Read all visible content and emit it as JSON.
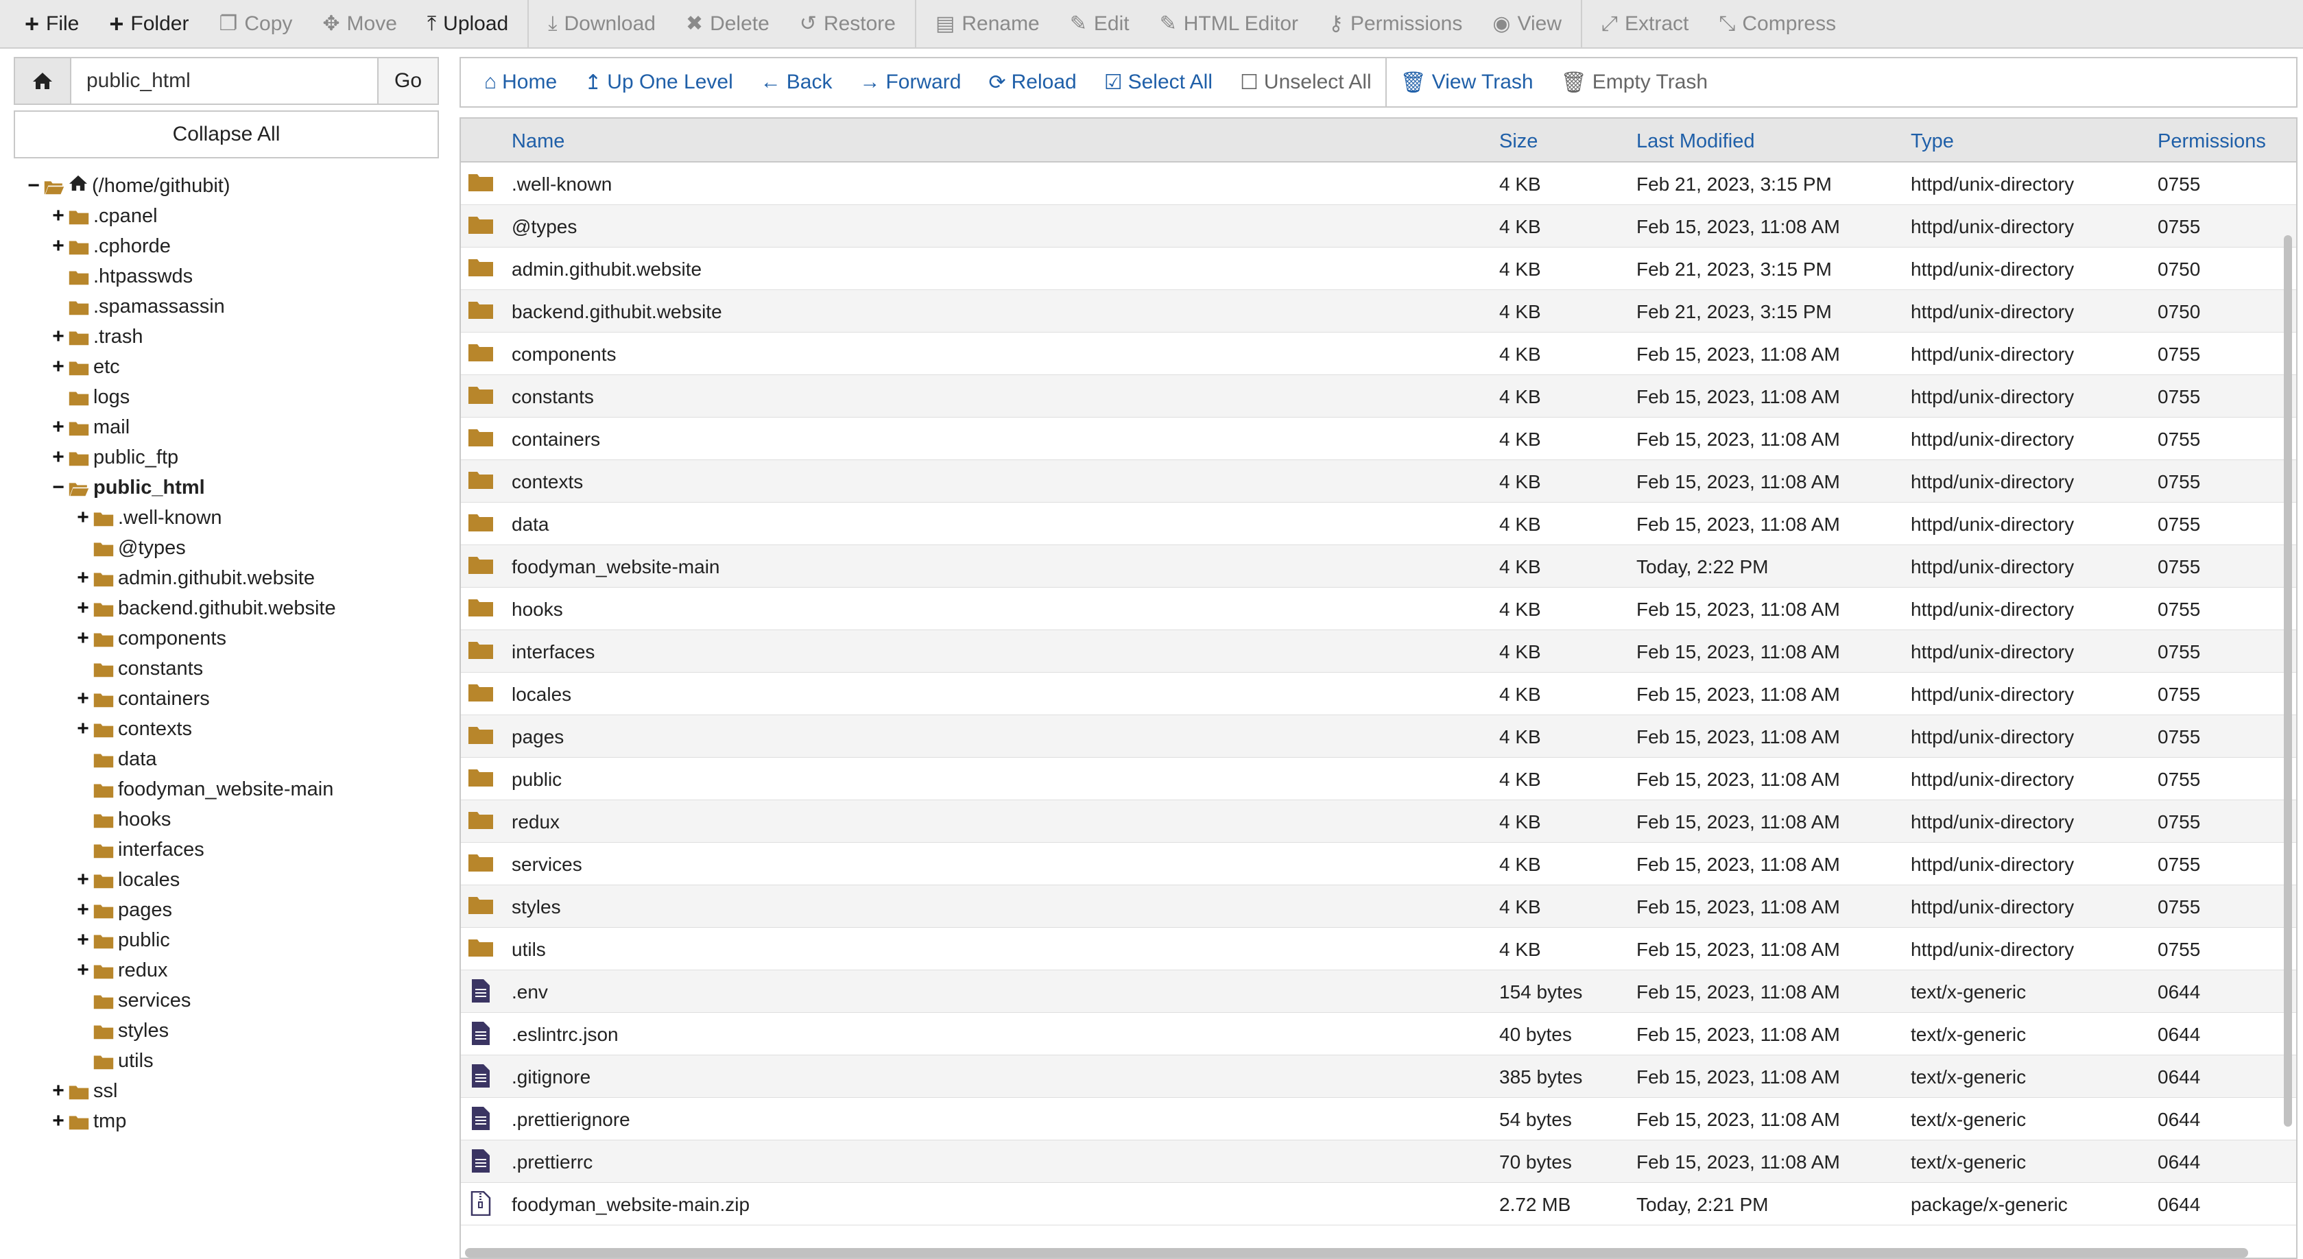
{
  "toolbar": {
    "items": [
      {
        "label": "File",
        "icon": "plus-icon",
        "active": true
      },
      {
        "label": "Folder",
        "icon": "plus-icon",
        "active": true
      },
      {
        "label": "Copy",
        "icon": "copy-icon",
        "active": false
      },
      {
        "label": "Move",
        "icon": "move-icon",
        "active": false
      },
      {
        "label": "Upload",
        "icon": "upload-icon",
        "active": true
      },
      {
        "label": "Download",
        "icon": "download-icon",
        "active": false
      },
      {
        "label": "Delete",
        "icon": "delete-icon",
        "active": false
      },
      {
        "label": "Restore",
        "icon": "restore-icon",
        "active": false
      },
      {
        "label": "Rename",
        "icon": "rename-icon",
        "active": false
      },
      {
        "label": "Edit",
        "icon": "edit-icon",
        "active": false
      },
      {
        "label": "HTML Editor",
        "icon": "html-editor-icon",
        "active": false
      },
      {
        "label": "Permissions",
        "icon": "key-icon",
        "active": false
      },
      {
        "label": "View",
        "icon": "eye-icon",
        "active": false
      },
      {
        "label": "Extract",
        "icon": "extract-icon",
        "active": false
      },
      {
        "label": "Compress",
        "icon": "compress-icon",
        "active": false
      }
    ]
  },
  "path": {
    "value": "public_html",
    "go_label": "Go"
  },
  "collapse_label": "Collapse All",
  "tree": [
    {
      "label": "(/home/githubit)",
      "level": 0,
      "expander": "−",
      "home": true,
      "open": true
    },
    {
      "label": ".cpanel",
      "level": 1,
      "expander": "+"
    },
    {
      "label": ".cphorde",
      "level": 1,
      "expander": "+"
    },
    {
      "label": ".htpasswds",
      "level": 1,
      "expander": ""
    },
    {
      "label": ".spamassassin",
      "level": 1,
      "expander": ""
    },
    {
      "label": ".trash",
      "level": 1,
      "expander": "+"
    },
    {
      "label": "etc",
      "level": 1,
      "expander": "+"
    },
    {
      "label": "logs",
      "level": 1,
      "expander": ""
    },
    {
      "label": "mail",
      "level": 1,
      "expander": "+"
    },
    {
      "label": "public_ftp",
      "level": 1,
      "expander": "+"
    },
    {
      "label": "public_html",
      "level": 1,
      "expander": "−",
      "open": true,
      "selected": true
    },
    {
      "label": ".well-known",
      "level": 2,
      "expander": "+"
    },
    {
      "label": "@types",
      "level": 2,
      "expander": ""
    },
    {
      "label": "admin.githubit.website",
      "level": 2,
      "expander": "+"
    },
    {
      "label": "backend.githubit.website",
      "level": 2,
      "expander": "+"
    },
    {
      "label": "components",
      "level": 2,
      "expander": "+"
    },
    {
      "label": "constants",
      "level": 2,
      "expander": ""
    },
    {
      "label": "containers",
      "level": 2,
      "expander": "+"
    },
    {
      "label": "contexts",
      "level": 2,
      "expander": "+"
    },
    {
      "label": "data",
      "level": 2,
      "expander": ""
    },
    {
      "label": "foodyman_website-main",
      "level": 2,
      "expander": ""
    },
    {
      "label": "hooks",
      "level": 2,
      "expander": ""
    },
    {
      "label": "interfaces",
      "level": 2,
      "expander": ""
    },
    {
      "label": "locales",
      "level": 2,
      "expander": "+"
    },
    {
      "label": "pages",
      "level": 2,
      "expander": "+"
    },
    {
      "label": "public",
      "level": 2,
      "expander": "+"
    },
    {
      "label": "redux",
      "level": 2,
      "expander": "+"
    },
    {
      "label": "services",
      "level": 2,
      "expander": ""
    },
    {
      "label": "styles",
      "level": 2,
      "expander": ""
    },
    {
      "label": "utils",
      "level": 2,
      "expander": ""
    },
    {
      "label": "ssl",
      "level": 1,
      "expander": "+"
    },
    {
      "label": "tmp",
      "level": 1,
      "expander": "+"
    }
  ],
  "nav": {
    "items": [
      {
        "label": "Home",
        "icon": "home-icon"
      },
      {
        "label": "Up One Level",
        "icon": "level-up-icon"
      },
      {
        "label": "Back",
        "icon": "arrow-left-icon"
      },
      {
        "label": "Forward",
        "icon": "arrow-right-icon"
      },
      {
        "label": "Reload",
        "icon": "reload-icon"
      },
      {
        "label": "Select All",
        "icon": "checkbox-checked-icon"
      },
      {
        "label": "Unselect All",
        "icon": "checkbox-empty-icon",
        "muted": true
      },
      {
        "label": "View Trash",
        "icon": "trash-icon"
      },
      {
        "label": "Empty Trash",
        "icon": "trash-icon",
        "muted": true
      }
    ]
  },
  "columns": {
    "name": "Name",
    "size": "Size",
    "modified": "Last Modified",
    "type": "Type",
    "perms": "Permissions"
  },
  "files": [
    {
      "name": ".well-known",
      "size": "4 KB",
      "modified": "Feb 21, 2023, 3:15 PM",
      "type": "httpd/unix-directory",
      "perms": "0755",
      "kind": "folder"
    },
    {
      "name": "@types",
      "size": "4 KB",
      "modified": "Feb 15, 2023, 11:08 AM",
      "type": "httpd/unix-directory",
      "perms": "0755",
      "kind": "folder"
    },
    {
      "name": "admin.githubit.website",
      "size": "4 KB",
      "modified": "Feb 21, 2023, 3:15 PM",
      "type": "httpd/unix-directory",
      "perms": "0750",
      "kind": "folder"
    },
    {
      "name": "backend.githubit.website",
      "size": "4 KB",
      "modified": "Feb 21, 2023, 3:15 PM",
      "type": "httpd/unix-directory",
      "perms": "0750",
      "kind": "folder"
    },
    {
      "name": "components",
      "size": "4 KB",
      "modified": "Feb 15, 2023, 11:08 AM",
      "type": "httpd/unix-directory",
      "perms": "0755",
      "kind": "folder"
    },
    {
      "name": "constants",
      "size": "4 KB",
      "modified": "Feb 15, 2023, 11:08 AM",
      "type": "httpd/unix-directory",
      "perms": "0755",
      "kind": "folder"
    },
    {
      "name": "containers",
      "size": "4 KB",
      "modified": "Feb 15, 2023, 11:08 AM",
      "type": "httpd/unix-directory",
      "perms": "0755",
      "kind": "folder"
    },
    {
      "name": "contexts",
      "size": "4 KB",
      "modified": "Feb 15, 2023, 11:08 AM",
      "type": "httpd/unix-directory",
      "perms": "0755",
      "kind": "folder"
    },
    {
      "name": "data",
      "size": "4 KB",
      "modified": "Feb 15, 2023, 11:08 AM",
      "type": "httpd/unix-directory",
      "perms": "0755",
      "kind": "folder"
    },
    {
      "name": "foodyman_website-main",
      "size": "4 KB",
      "modified": "Today, 2:22 PM",
      "type": "httpd/unix-directory",
      "perms": "0755",
      "kind": "folder"
    },
    {
      "name": "hooks",
      "size": "4 KB",
      "modified": "Feb 15, 2023, 11:08 AM",
      "type": "httpd/unix-directory",
      "perms": "0755",
      "kind": "folder"
    },
    {
      "name": "interfaces",
      "size": "4 KB",
      "modified": "Feb 15, 2023, 11:08 AM",
      "type": "httpd/unix-directory",
      "perms": "0755",
      "kind": "folder"
    },
    {
      "name": "locales",
      "size": "4 KB",
      "modified": "Feb 15, 2023, 11:08 AM",
      "type": "httpd/unix-directory",
      "perms": "0755",
      "kind": "folder"
    },
    {
      "name": "pages",
      "size": "4 KB",
      "modified": "Feb 15, 2023, 11:08 AM",
      "type": "httpd/unix-directory",
      "perms": "0755",
      "kind": "folder"
    },
    {
      "name": "public",
      "size": "4 KB",
      "modified": "Feb 15, 2023, 11:08 AM",
      "type": "httpd/unix-directory",
      "perms": "0755",
      "kind": "folder"
    },
    {
      "name": "redux",
      "size": "4 KB",
      "modified": "Feb 15, 2023, 11:08 AM",
      "type": "httpd/unix-directory",
      "perms": "0755",
      "kind": "folder"
    },
    {
      "name": "services",
      "size": "4 KB",
      "modified": "Feb 15, 2023, 11:08 AM",
      "type": "httpd/unix-directory",
      "perms": "0755",
      "kind": "folder"
    },
    {
      "name": "styles",
      "size": "4 KB",
      "modified": "Feb 15, 2023, 11:08 AM",
      "type": "httpd/unix-directory",
      "perms": "0755",
      "kind": "folder"
    },
    {
      "name": "utils",
      "size": "4 KB",
      "modified": "Feb 15, 2023, 11:08 AM",
      "type": "httpd/unix-directory",
      "perms": "0755",
      "kind": "folder"
    },
    {
      "name": ".env",
      "size": "154 bytes",
      "modified": "Feb 15, 2023, 11:08 AM",
      "type": "text/x-generic",
      "perms": "0644",
      "kind": "file"
    },
    {
      "name": ".eslintrc.json",
      "size": "40 bytes",
      "modified": "Feb 15, 2023, 11:08 AM",
      "type": "text/x-generic",
      "perms": "0644",
      "kind": "file"
    },
    {
      "name": ".gitignore",
      "size": "385 bytes",
      "modified": "Feb 15, 2023, 11:08 AM",
      "type": "text/x-generic",
      "perms": "0644",
      "kind": "file"
    },
    {
      "name": ".prettierignore",
      "size": "54 bytes",
      "modified": "Feb 15, 2023, 11:08 AM",
      "type": "text/x-generic",
      "perms": "0644",
      "kind": "file"
    },
    {
      "name": ".prettierrc",
      "size": "70 bytes",
      "modified": "Feb 15, 2023, 11:08 AM",
      "type": "text/x-generic",
      "perms": "0644",
      "kind": "file"
    },
    {
      "name": "foodyman_website-main.zip",
      "size": "2.72 MB",
      "modified": "Today, 2:21 PM",
      "type": "package/x-generic",
      "perms": "0644",
      "kind": "zip"
    }
  ],
  "colors": {
    "accent": "#1f5fa8",
    "folder": "#b8862b",
    "file": "#3b3563",
    "toolbar_bg": "#e9e9e9"
  }
}
